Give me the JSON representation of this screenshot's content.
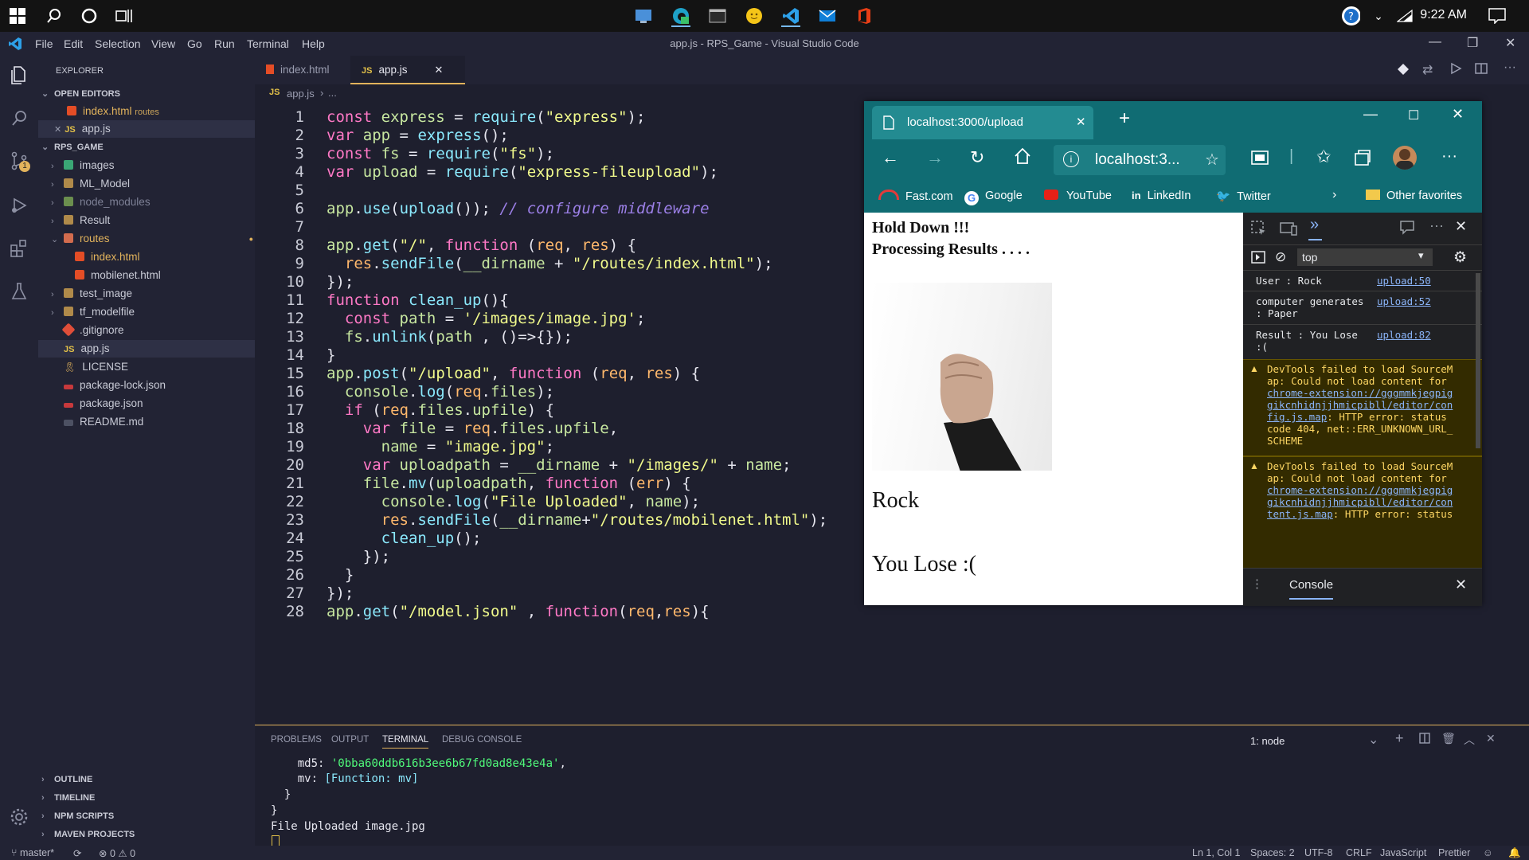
{
  "taskbar": {
    "time": "9:22 AM",
    "apps": [
      "task-manager-icon",
      "edge-icon",
      "terminal-icon",
      "emoji-icon",
      "vscode-icon",
      "mail-icon",
      "office-icon"
    ]
  },
  "window": {
    "title": "app.js - RPS_Game - Visual Studio Code",
    "menu": [
      "File",
      "Edit",
      "Selection",
      "View",
      "Go",
      "Run",
      "Terminal",
      "Help"
    ]
  },
  "sidebar": {
    "header": "EXPLORER",
    "open_editors": "OPEN EDITORS",
    "open_files": [
      {
        "name": "index.html",
        "hint": "routes",
        "status": "M"
      },
      {
        "name": "app.js",
        "hint": "",
        "status": ""
      }
    ],
    "project": "RPS_GAME",
    "tree": [
      {
        "name": "images",
        "type": "folder"
      },
      {
        "name": "ML_Model",
        "type": "folder"
      },
      {
        "name": "node_modules",
        "type": "folder"
      },
      {
        "name": "Result",
        "type": "folder"
      },
      {
        "name": "routes",
        "type": "folder-open"
      },
      {
        "name": "index.html",
        "type": "html",
        "status": "M"
      },
      {
        "name": "mobilenet.html",
        "type": "html"
      },
      {
        "name": "test_image",
        "type": "folder"
      },
      {
        "name": "tf_modelfile",
        "type": "folder"
      },
      {
        "name": ".gitignore",
        "type": "git"
      },
      {
        "name": "app.js",
        "type": "js"
      },
      {
        "name": "LICENSE",
        "type": "license"
      },
      {
        "name": "package-lock.json",
        "type": "json"
      },
      {
        "name": "package.json",
        "type": "json"
      },
      {
        "name": "README.md",
        "type": "md"
      }
    ],
    "bottom_sections": [
      "OUTLINE",
      "TIMELINE",
      "NPM SCRIPTS",
      "MAVEN PROJECTS"
    ]
  },
  "editor": {
    "tabs": [
      {
        "label": "index.html",
        "active": false
      },
      {
        "label": "app.js",
        "active": true
      }
    ],
    "breadcrumb": [
      "app.js",
      "..."
    ],
    "lines": [
      "const express = require(\"express\");",
      "var app = express();",
      "const fs = require(\"fs\");",
      "var upload = require(\"express-fileupload\");",
      "",
      "app.use(upload()); // configure middleware",
      "",
      "app.get(\"/\", function (req, res) {",
      "  res.sendFile(__dirname + \"/routes/index.html\");",
      "});",
      "function clean_up(){",
      "  const path = '/images/image.jpg';",
      "  fs.unlink(path , ()=>{});",
      "}",
      "app.post(\"/upload\", function (req, res) {",
      "  console.log(req.files);",
      "  if (req.files.upfile) {",
      "    var file = req.files.upfile,",
      "      name = \"image.jpg\";",
      "    var uploadpath = __dirname + \"/images/\" + name;",
      "    file.mv(uploadpath, function (err) {",
      "      console.log(\"File Uploaded\", name);",
      "      res.sendFile(__dirname+\"/routes/mobilenet.html\");",
      "      clean_up();",
      "    });",
      "  }",
      "});",
      "app.get(\"/model.json\" , function(req,res){"
    ]
  },
  "browser": {
    "tab_title": "localhost:3000/upload",
    "address": "localhost:3...",
    "favorites": [
      "Fast.com",
      "Google",
      "YouTube",
      "LinkedIn",
      "Twitter"
    ],
    "other_favorites": "Other favorites",
    "page": {
      "heading1": "Hold Down !!!",
      "heading2": "Processing Results . . . .",
      "prediction": "Rock",
      "result": "You Lose :("
    },
    "devtools": {
      "context": "top",
      "console_tab": "Console",
      "logs": [
        {
          "text": "User : Rock",
          "src": "upload:50"
        },
        {
          "text": "computer generates : Paper",
          "src": "upload:52"
        },
        {
          "text": "Result : You Lose :(",
          "src": "upload:82"
        }
      ],
      "warnings": [
        {
          "pre": "DevTools failed to load SourceMap: Could not load content for ",
          "link": "chrome-extension://gggmmkjegpiggikcnhidnjjhmicpibll/editor/config.js.map",
          "post": ": HTTP error: status code 404, net::ERR_UNKNOWN_URL_SCHEME"
        },
        {
          "pre": "DevTools failed to load SourceMap: Could not load content for ",
          "link": "chrome-extension://gggmmkjegpiggikcnhidnjjhmicpibll/editor/content.js.map",
          "post": ": HTTP error: status"
        }
      ]
    }
  },
  "panel": {
    "tabs": [
      "PROBLEMS",
      "OUTPUT",
      "TERMINAL",
      "DEBUG CONSOLE"
    ],
    "active_tab": "TERMINAL",
    "terminal_select": "1: node",
    "md5_label": "md5: ",
    "md5_value": "'0bba60ddb616b3ee6b67fd0ad8e43e4a'",
    "mv_label": "mv: ",
    "mv_value": "[Function: mv]",
    "close1": "}",
    "close2": "}",
    "uploaded": "File Uploaded image.jpg"
  },
  "status": {
    "branch": "master*",
    "errors": "0",
    "warnings": "0",
    "position": "Ln 1, Col 1",
    "spaces": "Spaces: 2",
    "encoding": "UTF-8",
    "eol": "CRLF",
    "language": "JavaScript",
    "formatter": "Prettier"
  }
}
